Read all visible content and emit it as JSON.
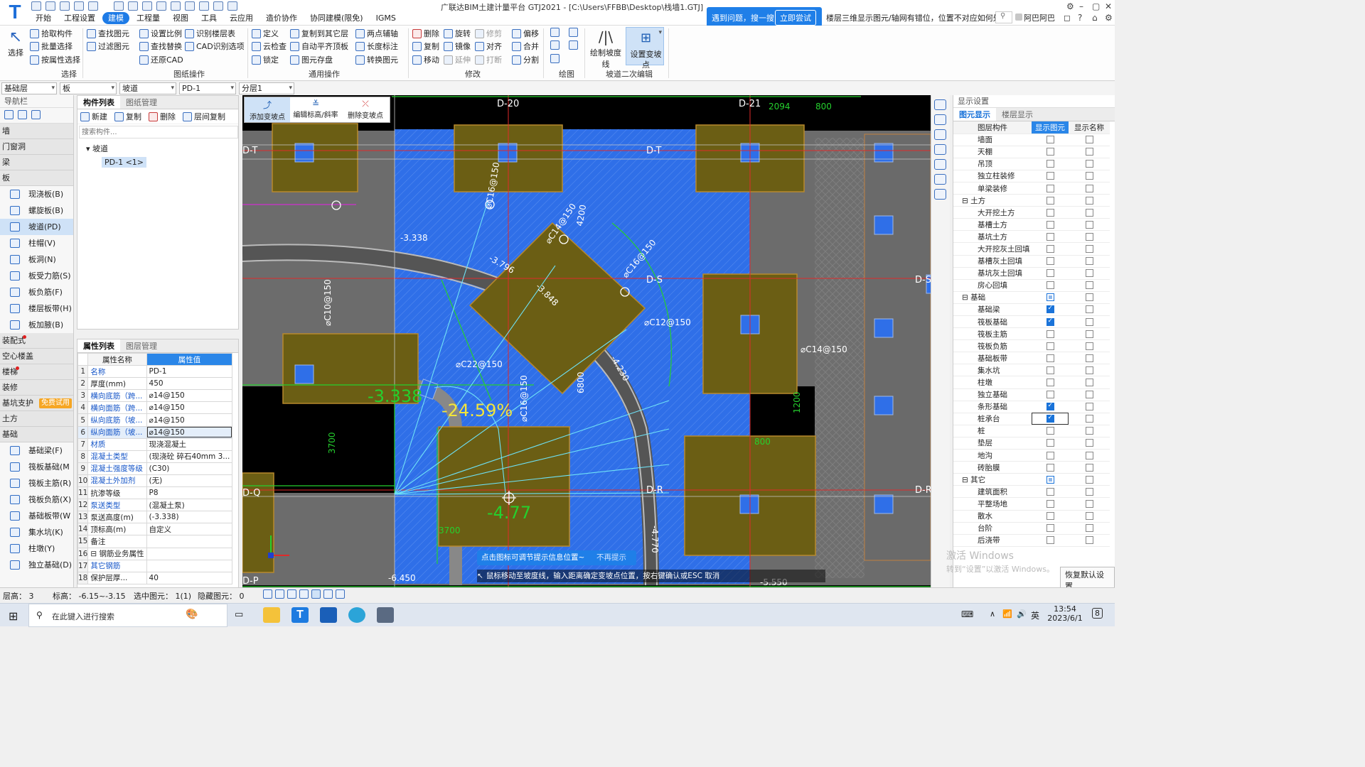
{
  "app": {
    "title": "广联达BIM土建计量平台 GTJ2021 - [C:\\Users\\FFBB\\Desktop\\栈墙1.GTJ]",
    "menu_tabs": [
      "开始",
      "工程设置",
      "建模",
      "工程量",
      "视图",
      "工具",
      "云应用",
      "造价协作",
      "协同建模(限免)",
      "IGMS"
    ],
    "active_tab": "建模",
    "help_banner": {
      "text": "遇到问题，搜一搜",
      "button": "立即尝试"
    },
    "question": "楼层三维显示图元/轴网有错位，位置不对应如何处理?",
    "user": "阿巴阿巴"
  },
  "ribbon": {
    "select": {
      "big": "选择",
      "items": [
        "拾取构件",
        "批量选择",
        "按属性选择"
      ],
      "group": "选择"
    },
    "cad": {
      "items": [
        "查找图元",
        "过滤图元",
        "设置比例",
        "识别楼层表",
        "查找替换",
        "CAD识别选项",
        "还原CAD"
      ],
      "group": "图纸操作"
    },
    "common": {
      "items": [
        "定义",
        "复制到其它层",
        "两点辅轴",
        "云检查",
        "自动平齐顶板",
        "长度标注",
        "锁定",
        "图元存盘",
        "转换图元"
      ],
      "group": "通用操作"
    },
    "modify": {
      "items": [
        "删除",
        "旋转",
        "修剪",
        "偏移",
        "复制",
        "镜像",
        "对齐",
        "合并",
        "移动",
        "延伸",
        "打断",
        "分割"
      ],
      "group": "修改"
    },
    "draw": {
      "group": "绘图"
    },
    "ramp": {
      "items": [
        "绘制坡度线",
        "设置变坡点"
      ],
      "group": "坡道二次编辑"
    }
  },
  "selectors": [
    "基础层",
    "板",
    "坡道",
    "PD-1",
    "分层1"
  ],
  "nav": {
    "title": "导航栏",
    "categories_top": [
      "墙",
      "门窗洞",
      "梁",
      "板"
    ],
    "board_items": [
      "现浇板(B)",
      "螺旋板(B)",
      "坡道(PD)",
      "柱帽(V)",
      "板洞(N)",
      "板受力筋(S)",
      "板负筋(F)",
      "楼层板带(H)",
      "板加腋(B)"
    ],
    "active_item": "坡道(PD)",
    "categories_mid": [
      "装配式",
      "空心楼盖",
      "楼梯",
      "装修",
      "基坑支护",
      "土方",
      "基础"
    ],
    "try_badge": "免费试用",
    "foundation_items": [
      "基础梁(F)",
      "筏板基础(M",
      "筏板主筋(R)",
      "筏板负筋(X)",
      "基础板带(W",
      "集水坑(K)",
      "柱墩(Y)",
      "独立基础(D)"
    ]
  },
  "component_list": {
    "tabs": [
      "构件列表",
      "图纸管理"
    ],
    "toolbar": [
      "新建",
      "复制",
      "删除",
      "层间复制"
    ],
    "search_placeholder": "搜索构件...",
    "tree_root": "坡道",
    "tree_item": "PD-1 <1>"
  },
  "properties": {
    "tabs": [
      "属性列表",
      "图层管理"
    ],
    "headers": [
      "属性名称",
      "属性值"
    ],
    "rows": [
      {
        "n": "1",
        "k": "名称",
        "v": "PD-1",
        "link": true
      },
      {
        "n": "2",
        "k": "厚度(mm)",
        "v": "450",
        "link": false
      },
      {
        "n": "3",
        "k": "横向底筋（跨...",
        "v": "⌀14@150",
        "link": true
      },
      {
        "n": "4",
        "k": "横向面筋（跨...",
        "v": "⌀14@150",
        "link": true
      },
      {
        "n": "5",
        "k": "纵向底筋（坡...",
        "v": "⌀14@150",
        "link": true
      },
      {
        "n": "6",
        "k": "纵向面筋（坡...",
        "v": "⌀14@150",
        "link": true
      },
      {
        "n": "7",
        "k": "材质",
        "v": "现浇混凝土",
        "link": true
      },
      {
        "n": "8",
        "k": "混凝土类型",
        "v": "(现浇砼 碎石40mm 3...",
        "link": true
      },
      {
        "n": "9",
        "k": "混凝土强度等级",
        "v": "(C30)",
        "link": true
      },
      {
        "n": "10",
        "k": "混凝土外加剂",
        "v": "(无)",
        "link": true
      },
      {
        "n": "11",
        "k": "抗渗等级",
        "v": "P8",
        "link": false
      },
      {
        "n": "12",
        "k": "泵送类型",
        "v": "(混凝土泵)",
        "link": true
      },
      {
        "n": "13",
        "k": "泵送高度(m)",
        "v": "(-3.338)",
        "link": false
      },
      {
        "n": "14",
        "k": "顶标高(m)",
        "v": "自定义",
        "link": false
      },
      {
        "n": "15",
        "k": "备注",
        "v": "",
        "link": false
      },
      {
        "n": "16",
        "k": "⊟ 钢筋业务属性",
        "v": "",
        "link": false
      },
      {
        "n": "17",
        "k": "其它钢筋",
        "v": "",
        "link": true
      },
      {
        "n": "18",
        "k": "保护层厚...",
        "v": "40",
        "link": false
      }
    ]
  },
  "canvas": {
    "float_toolbar": [
      "添加变坡点",
      "编辑标高/斜率",
      "删除变坡点"
    ],
    "axes": [
      "D-20",
      "D-21",
      "D-T",
      "D-S",
      "D-R",
      "D-Q",
      "D-P"
    ],
    "dims": [
      "2094",
      "800",
      "3700",
      "3700",
      "1200",
      "800",
      "6800",
      "-4.770",
      "4200"
    ],
    "rebar_labels": [
      "⌀C14@150",
      "⌀C16@150",
      "⌀C16@150",
      "⌀C12@150",
      "⌀C22@150",
      "⌀C14@150",
      "⌀C10@150",
      "⌀C16@150"
    ],
    "elevations": [
      "-3.338",
      "-3.796",
      "-3.848",
      "-4.230",
      "-6.450",
      "-5.550"
    ],
    "big_elev1": "-3.338",
    "big_slope": "-24.59%",
    "big_elev2": "-4.77",
    "hint_text": "点击图标可调节提示信息位置~",
    "hint_btn": "不再提示",
    "command_tip": "鼠标移动至坡度线，输入距离确定变坡点位置，按右键确认或ESC 取消"
  },
  "display_settings": {
    "title": "显示设置",
    "tabs": [
      "图元显示",
      "楼层显示"
    ],
    "headers": [
      "图层构件",
      "显示图元",
      "显示名称"
    ],
    "rows": [
      {
        "label": "墙面",
        "indent": 2,
        "show": false,
        "name": false
      },
      {
        "label": "天棚",
        "indent": 2,
        "show": false,
        "name": false
      },
      {
        "label": "吊顶",
        "indent": 2,
        "show": false,
        "name": false
      },
      {
        "label": "独立柱装修",
        "indent": 2,
        "show": false,
        "name": false
      },
      {
        "label": "单梁装修",
        "indent": 2,
        "show": false,
        "name": false
      },
      {
        "label": "⊟ 土方",
        "indent": 1,
        "show": false,
        "name": false
      },
      {
        "label": "大开挖土方",
        "indent": 2,
        "show": false,
        "name": false
      },
      {
        "label": "基槽土方",
        "indent": 2,
        "show": false,
        "name": false
      },
      {
        "label": "基坑土方",
        "indent": 2,
        "show": false,
        "name": false
      },
      {
        "label": "大开挖灰土回填",
        "indent": 2,
        "show": false,
        "name": false
      },
      {
        "label": "基槽灰土回填",
        "indent": 2,
        "show": false,
        "name": false
      },
      {
        "label": "基坑灰土回填",
        "indent": 2,
        "show": false,
        "name": false
      },
      {
        "label": "房心回填",
        "indent": 2,
        "show": false,
        "name": false
      },
      {
        "label": "⊟ 基础",
        "indent": 1,
        "show": "half",
        "name": false
      },
      {
        "label": "基础梁",
        "indent": 2,
        "show": true,
        "name": false
      },
      {
        "label": "筏板基础",
        "indent": 2,
        "show": true,
        "name": false
      },
      {
        "label": "筏板主筋",
        "indent": 2,
        "show": false,
        "name": false
      },
      {
        "label": "筏板负筋",
        "indent": 2,
        "show": false,
        "name": false
      },
      {
        "label": "基础板带",
        "indent": 2,
        "show": false,
        "name": false
      },
      {
        "label": "集水坑",
        "indent": 2,
        "show": false,
        "name": false
      },
      {
        "label": "柱墩",
        "indent": 2,
        "show": false,
        "name": false
      },
      {
        "label": "独立基础",
        "indent": 2,
        "show": false,
        "name": false
      },
      {
        "label": "条形基础",
        "indent": 2,
        "show": true,
        "name": false
      },
      {
        "label": "桩承台",
        "indent": 2,
        "show": true,
        "name": false
      },
      {
        "label": "桩",
        "indent": 2,
        "show": false,
        "name": false
      },
      {
        "label": "垫层",
        "indent": 2,
        "show": false,
        "name": false
      },
      {
        "label": "地沟",
        "indent": 2,
        "show": false,
        "name": false
      },
      {
        "label": "砖胎膜",
        "indent": 2,
        "show": false,
        "name": false
      },
      {
        "label": "⊟ 其它",
        "indent": 1,
        "show": "half",
        "name": false
      },
      {
        "label": "建筑面积",
        "indent": 2,
        "show": false,
        "name": false
      },
      {
        "label": "平整场地",
        "indent": 2,
        "show": false,
        "name": false
      },
      {
        "label": "散水",
        "indent": 2,
        "show": false,
        "name": false
      },
      {
        "label": "台阶",
        "indent": 2,
        "show": false,
        "name": false
      },
      {
        "label": "后浇带",
        "indent": 2,
        "show": false,
        "name": false
      }
    ],
    "restore_button": "恢复默认设置",
    "watermark1": "激活 Windows",
    "watermark2": "转到“设置”以激活 Windows。"
  },
  "status": {
    "floor": "层高： 3",
    "elev": "标高： -6.15~-3.15",
    "selected": "选中图元： 1(1)",
    "hidden": "隐藏图元： 0"
  },
  "taskbar": {
    "search": "在此键入进行搜索",
    "time": "13:54",
    "date": "2023/6/1",
    "lang": "英",
    "notif": "8"
  },
  "colors": {
    "accent": "#1e7be6",
    "slab": "#2f6fe8",
    "footing": "#6b5e14",
    "axis_red": "#e02a2a",
    "green": "#25d02e",
    "canvas_bg": "#000000"
  }
}
